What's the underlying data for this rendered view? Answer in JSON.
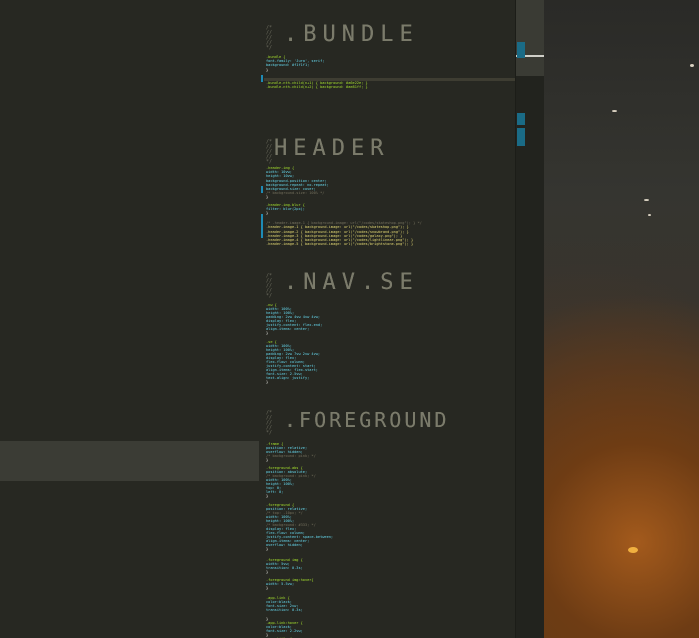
{
  "banners": [
    {
      "id": "bundle",
      "text": ".BUNDLE"
    },
    {
      "id": "header",
      "text": "HEADER"
    },
    {
      "id": "nav",
      "text": ".NAV.SE"
    },
    {
      "id": "foreground",
      "text": ".FOREGROUND"
    }
  ],
  "code": {
    "bundle": [
      {
        "sel": ".bundle {",
        "kind": "sel"
      },
      {
        "sel": "  font-family: 'Jura', serif;",
        "kind": "prop"
      },
      {
        "sel": "  background: #f1f1f1;",
        "kind": "prop"
      },
      {
        "sel": "}",
        "kind": "pun"
      },
      {
        "sel": ".bundle-nth-child(n+1) { background: #a6e22e; }",
        "kind": "sel"
      },
      {
        "sel": ".bundle-nth-child(n+2) { background: #ae81ff; }",
        "kind": "sel"
      }
    ],
    "header": [
      {
        "sel": ".header-img {",
        "kind": "sel"
      },
      {
        "sel": "  width: 10vw;",
        "kind": "prop"
      },
      {
        "sel": "  height: 10vw;",
        "kind": "prop"
      },
      {
        "sel": "  background-position: center;",
        "kind": "prop"
      },
      {
        "sel": "  background-repeat: no-repeat;",
        "kind": "prop"
      },
      {
        "sel": "  background-size: cover;",
        "kind": "prop"
      },
      {
        "sel": "  /* background-size: 100% */",
        "kind": "com"
      },
      {
        "sel": "}",
        "kind": "pun"
      },
      {
        "sel": ".header-img.blur {",
        "kind": "sel"
      },
      {
        "sel": "  filter: blur(2px);",
        "kind": "prop"
      },
      {
        "sel": "}",
        "kind": "pun"
      },
      {
        "sel": "/* .header-image-1 { background-image: url(\"/codes/skateshop.png\"); } */",
        "kind": "com"
      },
      {
        "sel": ".header-image-1 { background-image: url(\"/codes/skateshop.png\"); }",
        "kind": "str"
      },
      {
        "sel": ".header-image-2 { background-image: url(\"/codes/snowbrand.png\"); }",
        "kind": "str"
      },
      {
        "sel": ".header-image-3 { background-image: url(\"/codes/galaxy.png\"); }",
        "kind": "str"
      },
      {
        "sel": ".header-image-4 { background-image: url(\"/codes/lightlinear.png\"); }",
        "kind": "str"
      },
      {
        "sel": ".header-image-5 { background-image: url(\"/codes/brightstone.png\"); }",
        "kind": "str"
      }
    ],
    "nav": [
      {
        "sel": ".nw {",
        "kind": "sel"
      },
      {
        "sel": "  width: 100%;",
        "kind": "prop"
      },
      {
        "sel": "  height: 100%;",
        "kind": "prop"
      },
      {
        "sel": "  padding: 2vw 4vw 4vw 4vw;",
        "kind": "prop"
      },
      {
        "sel": "  display: flex;",
        "kind": "prop"
      },
      {
        "sel": "  justify-content: flex-end;",
        "kind": "prop"
      },
      {
        "sel": "  align-items: center;",
        "kind": "prop"
      },
      {
        "sel": "}",
        "kind": "pun"
      },
      {
        "sel": ".se {",
        "kind": "sel"
      },
      {
        "sel": "  width: 100%;",
        "kind": "prop"
      },
      {
        "sel": "  height: 100%;",
        "kind": "prop"
      },
      {
        "sel": "  padding: 2vw 7vw 2vw 4vw;",
        "kind": "prop"
      },
      {
        "sel": "  display: flex;",
        "kind": "prop"
      },
      {
        "sel": "  flex-flow: column;",
        "kind": "prop"
      },
      {
        "sel": "  justify-content: start;",
        "kind": "prop"
      },
      {
        "sel": "  align-items: flex-start;",
        "kind": "prop"
      },
      {
        "sel": "  font-size: 2.5vw;",
        "kind": "prop"
      },
      {
        "sel": "  text-align: justify;",
        "kind": "prop"
      },
      {
        "sel": "}",
        "kind": "pun"
      }
    ],
    "foreground": [
      {
        "sel": ".frame {",
        "kind": "sel"
      },
      {
        "sel": "  position: relative;",
        "kind": "prop"
      },
      {
        "sel": "  overflow: hidden;",
        "kind": "prop"
      },
      {
        "sel": "  /* background: pink; */",
        "kind": "com"
      },
      {
        "sel": "}",
        "kind": "pun"
      },
      {
        "sel": ".foreground-abs {",
        "kind": "sel"
      },
      {
        "sel": "  position: absolute;",
        "kind": "prop"
      },
      {
        "sel": "  /* background: pink; */",
        "kind": "com"
      },
      {
        "sel": "  width: 100%;",
        "kind": "prop"
      },
      {
        "sel": "  height: 100%;",
        "kind": "prop"
      },
      {
        "sel": "  top: 0;",
        "kind": "prop"
      },
      {
        "sel": "  left: 0;",
        "kind": "prop"
      },
      {
        "sel": "}",
        "kind": "pun"
      },
      {
        "sel": ".foreground {",
        "kind": "sel"
      },
      {
        "sel": "  position: relative;",
        "kind": "prop"
      },
      {
        "sel": "  /* top: -10px; */",
        "kind": "com"
      },
      {
        "sel": "  width: 100%;",
        "kind": "prop"
      },
      {
        "sel": "  height: 100%;",
        "kind": "prop"
      },
      {
        "sel": "  /* background: #333; */",
        "kind": "com"
      },
      {
        "sel": "  display: flex;",
        "kind": "prop"
      },
      {
        "sel": "  flex-flow: column;",
        "kind": "prop"
      },
      {
        "sel": "  justify-content: space-between;",
        "kind": "prop"
      },
      {
        "sel": "  align-items: center;",
        "kind": "prop"
      },
      {
        "sel": "  overflow: hidden;",
        "kind": "prop"
      },
      {
        "sel": "}",
        "kind": "pun"
      },
      {
        "sel": ".foreground img {",
        "kind": "sel"
      },
      {
        "sel": "  width: 5vw;",
        "kind": "prop"
      },
      {
        "sel": "  transition: 0.3s;",
        "kind": "prop"
      },
      {
        "sel": "}",
        "kind": "pun"
      },
      {
        "sel": ".foreground img:hover{",
        "kind": "sel"
      },
      {
        "sel": "  width: 5.5vw;",
        "kind": "prop"
      },
      {
        "sel": "}",
        "kind": "pun"
      },
      {
        "sel": ".app-link {",
        "kind": "sel"
      },
      {
        "sel": "  color:black;",
        "kind": "prop"
      },
      {
        "sel": "  font-size: 2vw;",
        "kind": "prop"
      },
      {
        "sel": "  transition: 0.3s;",
        "kind": "prop"
      },
      {
        "sel": "}",
        "kind": "pun"
      },
      {
        "sel": ".app-link:hover {",
        "kind": "sel"
      },
      {
        "sel": "  color:black;",
        "kind": "prop"
      },
      {
        "sel": "  font-size: 2.2vw;",
        "kind": "prop"
      },
      {
        "sel": "}",
        "kind": "pun"
      },
      {
        "sel": ".app-title {",
        "kind": "sel"
      }
    ]
  },
  "colors": {
    "editor_bg": "#272822",
    "selector": "#a6e22e",
    "property": "#66d9ef",
    "value": "#ae81ff",
    "string": "#e6db74",
    "comment": "#75715e"
  }
}
